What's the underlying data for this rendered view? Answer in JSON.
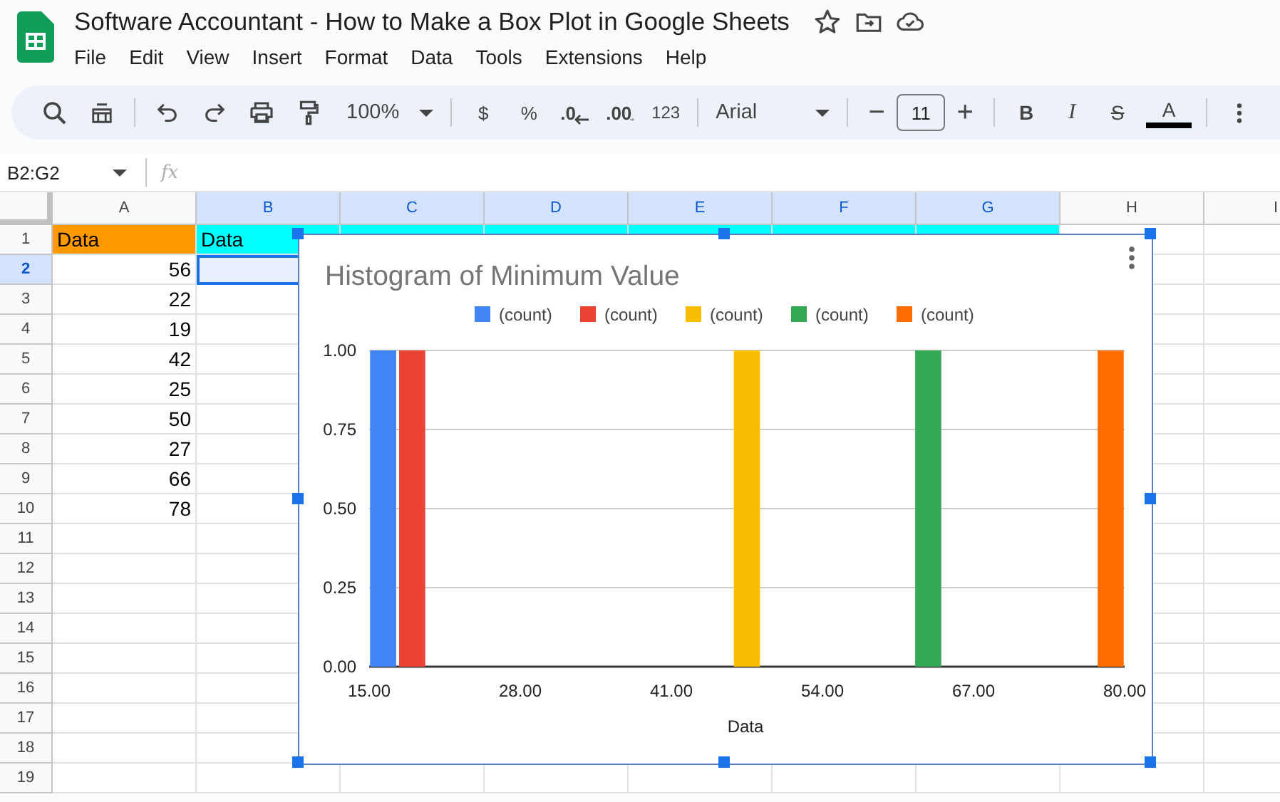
{
  "title_bar": {
    "title": "Software Accountant - How to Make a Box Plot in Google Sheets"
  },
  "menu": [
    "File",
    "Edit",
    "View",
    "Insert",
    "Format",
    "Data",
    "Tools",
    "Extensions",
    "Help"
  ],
  "toolbar": {
    "zoom": "100%",
    "currency": "$",
    "percent": "%",
    "decrease_decimal": ".0",
    "increase_decimal": ".00",
    "number_format": "123",
    "font": "Arial",
    "size_minus": "−",
    "font_size": "11",
    "size_plus": "+",
    "bold": "B",
    "italic": "I",
    "strikethrough": "S",
    "text_color": "A"
  },
  "formula_bar": {
    "name_box": "B2:G2",
    "formula_label": "fx"
  },
  "grid": {
    "columns": [
      {
        "label": "A",
        "selected": false
      },
      {
        "label": "B",
        "selected": true
      },
      {
        "label": "C",
        "selected": true
      },
      {
        "label": "D",
        "selected": true
      },
      {
        "label": "E",
        "selected": true
      },
      {
        "label": "F",
        "selected": true
      },
      {
        "label": "G",
        "selected": true
      },
      {
        "label": "H",
        "selected": false
      },
      {
        "label": "I",
        "selected": false
      }
    ],
    "rows": [
      {
        "label": "1",
        "selected": false,
        "cells": [
          {
            "kind": "text",
            "text": "Data",
            "color": "#ff9900",
            "selected": false
          },
          {
            "kind": "text",
            "text": "Data",
            "color": "#00ffff",
            "selected": false
          },
          {
            "kind": "text",
            "color": "#00ffff",
            "selected": false
          },
          {
            "kind": "text",
            "color": "#00ffff",
            "selected": false
          },
          {
            "kind": "text",
            "color": "#00ffff",
            "selected": false
          },
          {
            "kind": "text",
            "color": "#00ffff",
            "selected": false
          },
          {
            "kind": "text",
            "color": "#00ffff",
            "selected": false
          }
        ]
      },
      {
        "label": "2",
        "selected": true,
        "cells": [
          {
            "kind": "number",
            "text": "56",
            "selected": false
          },
          {
            "kind": "text",
            "selected": true
          }
        ]
      },
      {
        "label": "3",
        "selected": false,
        "cells": [
          {
            "kind": "number",
            "text": "22",
            "selected": false
          }
        ]
      },
      {
        "label": "4",
        "selected": false,
        "cells": [
          {
            "kind": "number",
            "text": "19",
            "selected": false
          }
        ]
      },
      {
        "label": "5",
        "selected": false,
        "cells": [
          {
            "kind": "number",
            "text": "42",
            "selected": false
          }
        ]
      },
      {
        "label": "6",
        "selected": false,
        "cells": [
          {
            "kind": "number",
            "text": "25",
            "selected": false
          }
        ]
      },
      {
        "label": "7",
        "selected": false,
        "cells": [
          {
            "kind": "number",
            "text": "50",
            "selected": false
          }
        ]
      },
      {
        "label": "8",
        "selected": false,
        "cells": [
          {
            "kind": "number",
            "text": "27",
            "selected": false
          }
        ]
      },
      {
        "label": "9",
        "selected": false,
        "cells": [
          {
            "kind": "number",
            "text": "66",
            "selected": false
          }
        ]
      },
      {
        "label": "10",
        "selected": false,
        "cells": [
          {
            "kind": "number",
            "text": "78",
            "selected": false
          }
        ]
      },
      {
        "label": "11",
        "selected": false
      },
      {
        "label": "12",
        "selected": false
      },
      {
        "label": "13",
        "selected": false
      },
      {
        "label": "14",
        "selected": false
      },
      {
        "label": "15",
        "selected": false
      },
      {
        "label": "16",
        "selected": false
      },
      {
        "label": "17",
        "selected": false
      },
      {
        "label": "18",
        "selected": false
      },
      {
        "label": "19",
        "selected": false
      }
    ]
  },
  "chart": {
    "chart_data": {
      "type": "bar",
      "title": "Histogram of Minimum Value",
      "xlabel": "Data",
      "x": [
        16.2,
        18.7,
        47.5,
        63.1,
        78.8
      ],
      "series": [
        {
          "name": "(count)",
          "color": "#4285f4",
          "values": [
            1,
            null,
            null,
            null,
            null
          ]
        },
        {
          "name": "(count)",
          "color": "#ea4335",
          "values": [
            null,
            1,
            null,
            null,
            null
          ]
        },
        {
          "name": "(count)",
          "color": "#fbbc04",
          "values": [
            null,
            null,
            1,
            null,
            null
          ]
        },
        {
          "name": "(count)",
          "color": "#34a853",
          "values": [
            null,
            null,
            null,
            1,
            null
          ]
        },
        {
          "name": "(count)",
          "color": "#ff6d01",
          "values": [
            null,
            null,
            null,
            null,
            1
          ]
        }
      ],
      "xlim": [
        15,
        80
      ],
      "ylim": [
        0,
        1
      ],
      "grid": true,
      "xticks": [
        {
          "value": 15,
          "label": "15.00"
        },
        {
          "value": 28,
          "label": "28.00"
        },
        {
          "value": 41,
          "label": "41.00"
        },
        {
          "value": 54,
          "label": "54.00"
        },
        {
          "value": 67,
          "label": "67.00"
        },
        {
          "value": 80,
          "label": "80.00"
        }
      ],
      "yticks": [
        {
          "value": 0,
          "label": "0.00"
        },
        {
          "value": 0.25,
          "label": "0.25"
        },
        {
          "value": 0.5,
          "label": "0.50"
        },
        {
          "value": 0.75,
          "label": "0.75"
        },
        {
          "value": 1,
          "label": "1.00"
        }
      ]
    }
  }
}
